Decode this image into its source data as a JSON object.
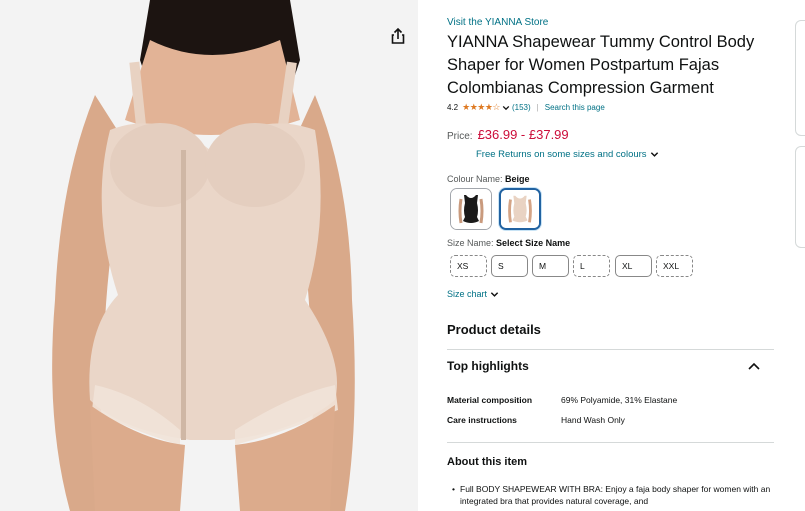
{
  "product": {
    "store_link": "Visit the YIANNA Store",
    "title": "YIANNA Shapewear Tummy Control Body Shaper for Women Postpartum Fajas Colombianas Compression Garment",
    "rating": "4.2",
    "stars_glyph": "★★★★☆",
    "rating_count": "(153)",
    "separator": "|",
    "search_link": "Search this page",
    "price_label": "Price:",
    "price": "£36.99 - £37.99",
    "returns_text": "Free Returns on some sizes and colours"
  },
  "colour": {
    "label": "Colour Name:",
    "selected": "Beige",
    "options": [
      "Black",
      "Beige"
    ]
  },
  "size": {
    "label": "Size Name:",
    "selected": "Select Size Name",
    "options": [
      "XS",
      "S",
      "M",
      "L",
      "XL",
      "XXL"
    ],
    "chart_link": "Size chart"
  },
  "details": {
    "heading": "Product details",
    "highlights_heading": "Top highlights",
    "specs": [
      {
        "key": "Material composition",
        "value": "69% Polyamide, 31% Elastane"
      },
      {
        "key": "Care instructions",
        "value": "Hand Wash Only"
      }
    ],
    "about_heading": "About this item",
    "bullet": "Full BODY SHAPEWEAR WITH BRA: Enjoy a faja body shaper for women with an integrated bra that provides natural coverage, and"
  },
  "colors": {
    "link": "#007185",
    "price": "#cc0c39",
    "star": "#de7921",
    "selected_border": "#2162a1"
  },
  "icons": [
    "share-icon",
    "chevron-down-icon",
    "chevron-up-icon"
  ]
}
